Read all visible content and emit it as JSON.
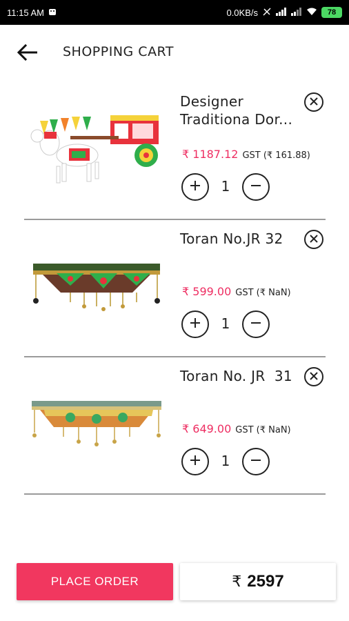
{
  "status_bar": {
    "time": "11:15 AM",
    "network_speed": "0.0KB/s",
    "battery": "78"
  },
  "header": {
    "title": "SHOPPING CART",
    "back_icon": "arrow-left-icon"
  },
  "cart": {
    "items": [
      {
        "name": "Designer Traditiona Dor...",
        "price": "₹ 1187.12",
        "gst": "GST (₹ 161.88)",
        "quantity": "1",
        "image": "ox-cart-figurine"
      },
      {
        "name": "Toran No.JR 32",
        "price": "₹ 599.00",
        "gst": "GST (₹ NaN)",
        "quantity": "1",
        "image": "toran-hanging"
      },
      {
        "name": "Toran No. JR  31",
        "price": "₹ 649.00",
        "gst": "GST (₹ NaN)",
        "quantity": "1",
        "image": "toran-hanging"
      }
    ]
  },
  "footer": {
    "place_order_label": "PLACE ORDER",
    "total_currency": "₹",
    "total_amount": "2597"
  },
  "colors": {
    "accent": "#f1375f",
    "price": "#ee2e62"
  }
}
